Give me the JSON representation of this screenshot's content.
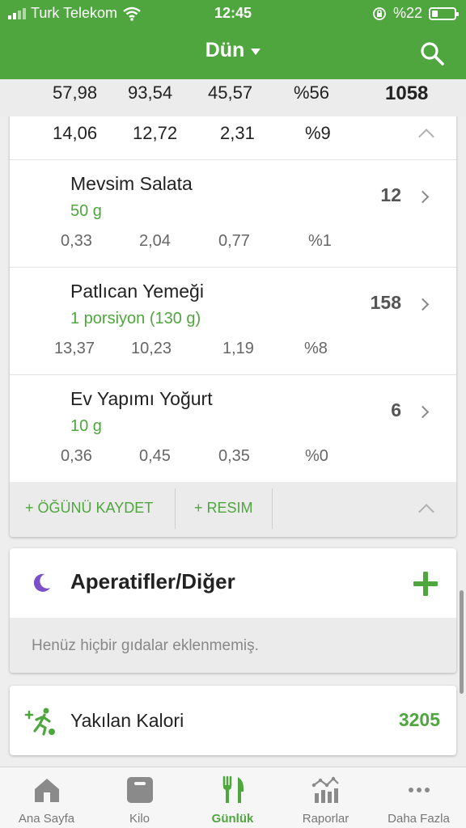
{
  "status": {
    "carrier": "Turk Telekom",
    "time": "12:45",
    "battery": "%22"
  },
  "nav": {
    "title": "Dün"
  },
  "totals": {
    "carbs": "57,98",
    "protein": "93,54",
    "fat": "45,57",
    "percent": "%56",
    "calories": "1058"
  },
  "meal": {
    "summary": {
      "carbs": "14,06",
      "protein": "12,72",
      "fat": "2,31",
      "percent": "%9"
    },
    "foods": [
      {
        "name": "Mevsim Salata",
        "portion": "50 g",
        "calories": "12",
        "carbs": "0,33",
        "protein": "2,04",
        "fat": "0,77",
        "percent": "%1"
      },
      {
        "name": "Patlıcan Yemeği",
        "portion": "1 porsiyon (130 g)",
        "calories": "158",
        "carbs": "13,37",
        "protein": "10,23",
        "fat": "1,19",
        "percent": "%8"
      },
      {
        "name": "Ev Yapımı Yoğurt",
        "portion": "10 g",
        "calories": "6",
        "carbs": "0,36",
        "protein": "0,45",
        "fat": "0,35",
        "percent": "%0"
      }
    ],
    "actions": {
      "save_meal": "+ ÖĞÜNÜ KAYDET",
      "photo": "+ RESIM"
    }
  },
  "snacks": {
    "title": "Aperatifler/Diğer",
    "empty": "Henüz hiçbir gıdalar eklenmemiş."
  },
  "burned": {
    "label": "Yakılan Kalori",
    "value": "3205"
  },
  "tabs": [
    {
      "label": "Ana Sayfa",
      "icon": "home-icon"
    },
    {
      "label": "Kilo",
      "icon": "scale-icon"
    },
    {
      "label": "Günlük",
      "icon": "fork-knife-icon",
      "active": true
    },
    {
      "label": "Raporlar",
      "icon": "reports-icon"
    },
    {
      "label": "Daha Fazla",
      "icon": "more-icon"
    }
  ],
  "colors": {
    "brand_green": "#4fa63e",
    "moon_purple": "#7b4fc9"
  }
}
